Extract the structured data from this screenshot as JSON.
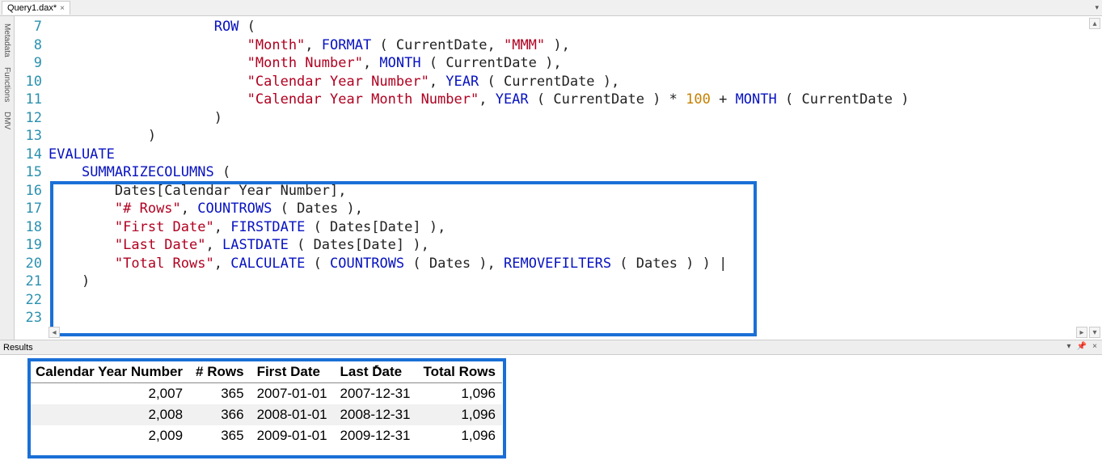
{
  "tab": {
    "title": "Query1.dax*",
    "close": "×"
  },
  "side_tabs": [
    "Metadata",
    "Functions",
    "DMV"
  ],
  "code_lines": [
    {
      "n": 7,
      "tokens": [
        [
          "                    ",
          "plain"
        ],
        [
          "ROW",
          "kw"
        ],
        [
          " (",
          "plain"
        ]
      ]
    },
    {
      "n": 8,
      "tokens": [
        [
          "                        ",
          "plain"
        ],
        [
          "\"Month\"",
          "str"
        ],
        [
          ", ",
          "plain"
        ],
        [
          "FORMAT",
          "fn"
        ],
        [
          " ( CurrentDate, ",
          "plain"
        ],
        [
          "\"MMM\"",
          "str"
        ],
        [
          " ),",
          "plain"
        ]
      ]
    },
    {
      "n": 9,
      "tokens": [
        [
          "                        ",
          "plain"
        ],
        [
          "\"Month Number\"",
          "str"
        ],
        [
          ", ",
          "plain"
        ],
        [
          "MONTH",
          "fn"
        ],
        [
          " ( CurrentDate ),",
          "plain"
        ]
      ]
    },
    {
      "n": 10,
      "tokens": [
        [
          "                        ",
          "plain"
        ],
        [
          "\"Calendar Year Number\"",
          "str"
        ],
        [
          ", ",
          "plain"
        ],
        [
          "YEAR",
          "fn"
        ],
        [
          " ( CurrentDate ),",
          "plain"
        ]
      ]
    },
    {
      "n": 11,
      "tokens": [
        [
          "                        ",
          "plain"
        ],
        [
          "\"Calendar Year Month Number\"",
          "str"
        ],
        [
          ", ",
          "plain"
        ],
        [
          "YEAR",
          "fn"
        ],
        [
          " ( CurrentDate ) * ",
          "plain"
        ],
        [
          "100",
          "num"
        ],
        [
          " + ",
          "plain"
        ],
        [
          "MONTH",
          "fn"
        ],
        [
          " ( CurrentDate )",
          "plain"
        ]
      ]
    },
    {
      "n": 12,
      "tokens": [
        [
          "",
          "plain"
        ]
      ]
    },
    {
      "n": 13,
      "tokens": [
        [
          "                    )",
          "plain"
        ]
      ]
    },
    {
      "n": 14,
      "tokens": [
        [
          "            )",
          "plain"
        ]
      ]
    },
    {
      "n": 15,
      "tokens": [
        [
          "",
          "plain"
        ]
      ]
    },
    {
      "n": 16,
      "tokens": [
        [
          "EVALUATE",
          "kw"
        ]
      ]
    },
    {
      "n": 17,
      "tokens": [
        [
          "    ",
          "plain"
        ],
        [
          "SUMMARIZECOLUMNS",
          "fn"
        ],
        [
          " (",
          "plain"
        ]
      ]
    },
    {
      "n": 18,
      "tokens": [
        [
          "        Dates[Calendar Year Number],",
          "plain"
        ]
      ]
    },
    {
      "n": 19,
      "tokens": [
        [
          "        ",
          "plain"
        ],
        [
          "\"# Rows\"",
          "str"
        ],
        [
          ", ",
          "plain"
        ],
        [
          "COUNTROWS",
          "fn"
        ],
        [
          " ( Dates ),",
          "plain"
        ]
      ]
    },
    {
      "n": 20,
      "tokens": [
        [
          "        ",
          "plain"
        ],
        [
          "\"First Date\"",
          "str"
        ],
        [
          ", ",
          "plain"
        ],
        [
          "FIRSTDATE",
          "fn"
        ],
        [
          " ( Dates[Date] ),",
          "plain"
        ]
      ]
    },
    {
      "n": 21,
      "tokens": [
        [
          "        ",
          "plain"
        ],
        [
          "\"Last Date\"",
          "str"
        ],
        [
          ", ",
          "plain"
        ],
        [
          "LASTDATE",
          "fn"
        ],
        [
          " ( Dates[Date] ),",
          "plain"
        ]
      ]
    },
    {
      "n": 22,
      "tokens": [
        [
          "        ",
          "plain"
        ],
        [
          "\"Total Rows\"",
          "str"
        ],
        [
          ", ",
          "plain"
        ],
        [
          "CALCULATE",
          "fn"
        ],
        [
          " ( ",
          "plain"
        ],
        [
          "COUNTROWS",
          "fn"
        ],
        [
          " ( Dates ), ",
          "plain"
        ],
        [
          "REMOVEFILTERS",
          "fn"
        ],
        [
          " ( Dates ) ) |",
          "plain"
        ]
      ]
    },
    {
      "n": 23,
      "tokens": [
        [
          "    )",
          "plain"
        ]
      ]
    }
  ],
  "results": {
    "title": "Results",
    "headers": [
      "Calendar Year Number",
      "# Rows",
      "First Date",
      "Last Date",
      "Total Rows"
    ],
    "rows": [
      [
        "2,007",
        "365",
        "2007-01-01",
        "2007-12-31",
        "1,096"
      ],
      [
        "2,008",
        "366",
        "2008-01-01",
        "2008-12-31",
        "1,096"
      ],
      [
        "2,009",
        "365",
        "2009-01-01",
        "2009-12-31",
        "1,096"
      ]
    ]
  },
  "chart_data": {
    "type": "table",
    "title": "Results",
    "columns": [
      "Calendar Year Number",
      "# Rows",
      "First Date",
      "Last Date",
      "Total Rows"
    ],
    "rows": [
      [
        2007,
        365,
        "2007-01-01",
        "2007-12-31",
        1096
      ],
      [
        2008,
        366,
        "2008-01-01",
        "2008-12-31",
        1096
      ],
      [
        2009,
        365,
        "2009-01-01",
        "2009-12-31",
        1096
      ]
    ]
  }
}
